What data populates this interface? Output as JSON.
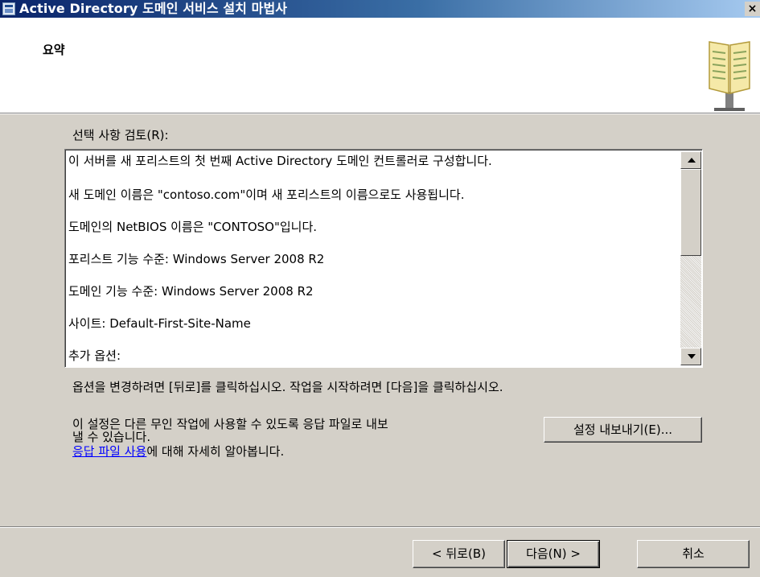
{
  "window": {
    "title": "Active Directory 도메인 서비스 설치 마법사",
    "close_glyph": "×"
  },
  "header": {
    "title": "요약"
  },
  "review": {
    "label": "선택 사항 검토(R):",
    "lines": [
      "이 서버를 새 포리스트의 첫 번째 Active Directory 도메인 컨트롤러로 구성합니다.",
      "새 도메인 이름은 \"contoso.com\"이며 새 포리스트의 이름으로도 사용됩니다.",
      "도메인의 NetBIOS 이름은 \"CONTOSO\"입니다.",
      "포리스트 기능 수준: Windows Server 2008 R2",
      "도메인 기능 수준: Windows Server 2008 R2",
      "사이트: Default-First-Site-Name",
      "추가 옵션:"
    ]
  },
  "instructions": "옵션을 변경하려면 [뒤로]를 클릭하십시오. 작업을 시작하려면 [다음]을 클릭하십시오.",
  "export": {
    "description_line1": "이 설정은 다른 무인 작업에 사용할 수 있도록 응답 파일로 내보",
    "description_line2": "낼 수 있습니다.",
    "link_text": "응답 파일 사용",
    "link_suffix": "에 대해 자세히 알아봅니다.",
    "button_label": "설정 내보내기(E)..."
  },
  "footer": {
    "back_label": "< 뒤로(B)",
    "next_label": "다음(N) >",
    "cancel_label": "취소"
  }
}
